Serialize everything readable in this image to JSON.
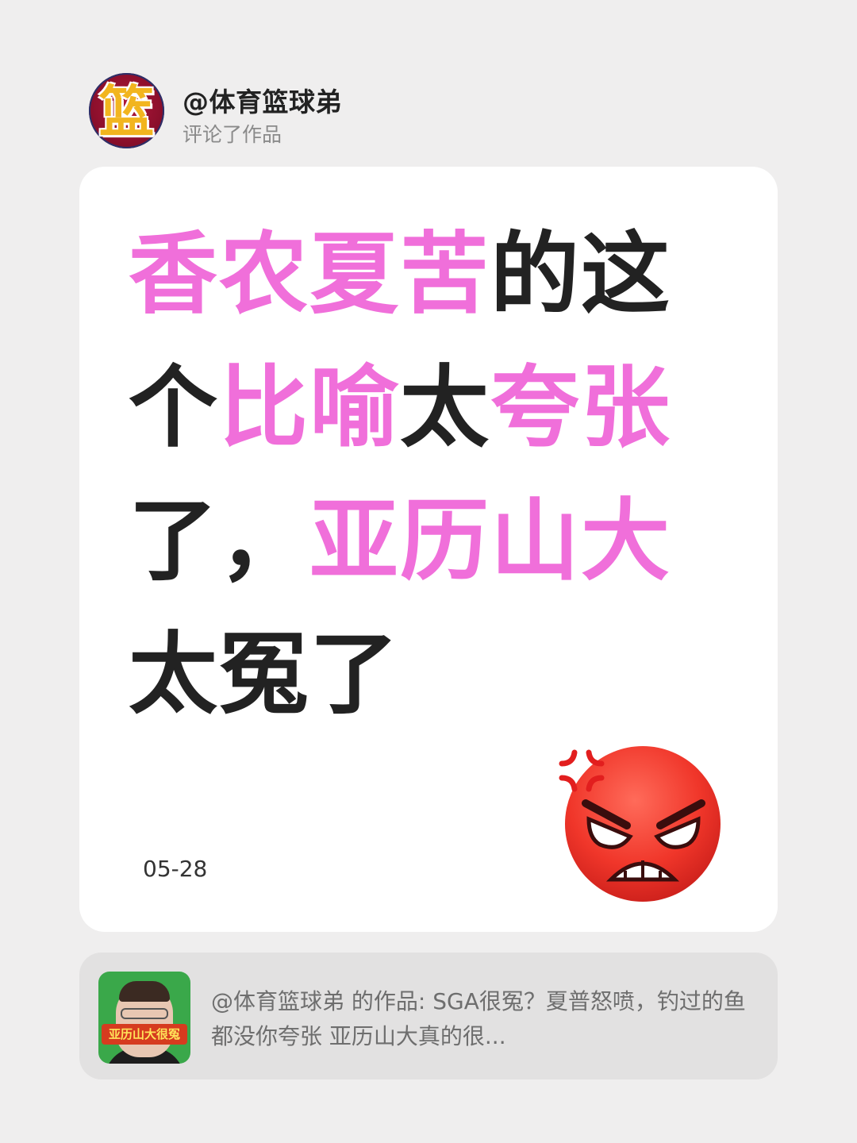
{
  "author": {
    "avatar_glyph": "篮",
    "username": "@体育篮球弟",
    "action": "评论了作品"
  },
  "comment": {
    "segments": [
      {
        "text": "香农夏苦",
        "color": "pink"
      },
      {
        "text": "的这个",
        "color": "dark"
      },
      {
        "text": "比喻",
        "color": "pink"
      },
      {
        "text": "太",
        "color": "dark"
      },
      {
        "text": "夸张",
        "color": "pink"
      },
      {
        "text": "了，",
        "color": "dark"
      },
      {
        "text": "亚历山大",
        "color": "pink"
      },
      {
        "text": "太冤了",
        "color": "dark"
      }
    ],
    "date": "05-28",
    "emoji": "angry-face-emoji"
  },
  "reference": {
    "thumbnail_banner": "亚历山大很冤",
    "text": "@体育篮球弟 的作品: SGA很冤？夏普怒喷，钓过的鱼都没你夸张 亚历山大真的很..."
  },
  "colors": {
    "background": "#efeeee",
    "pink": "#f06fda",
    "dark": "#222222"
  }
}
